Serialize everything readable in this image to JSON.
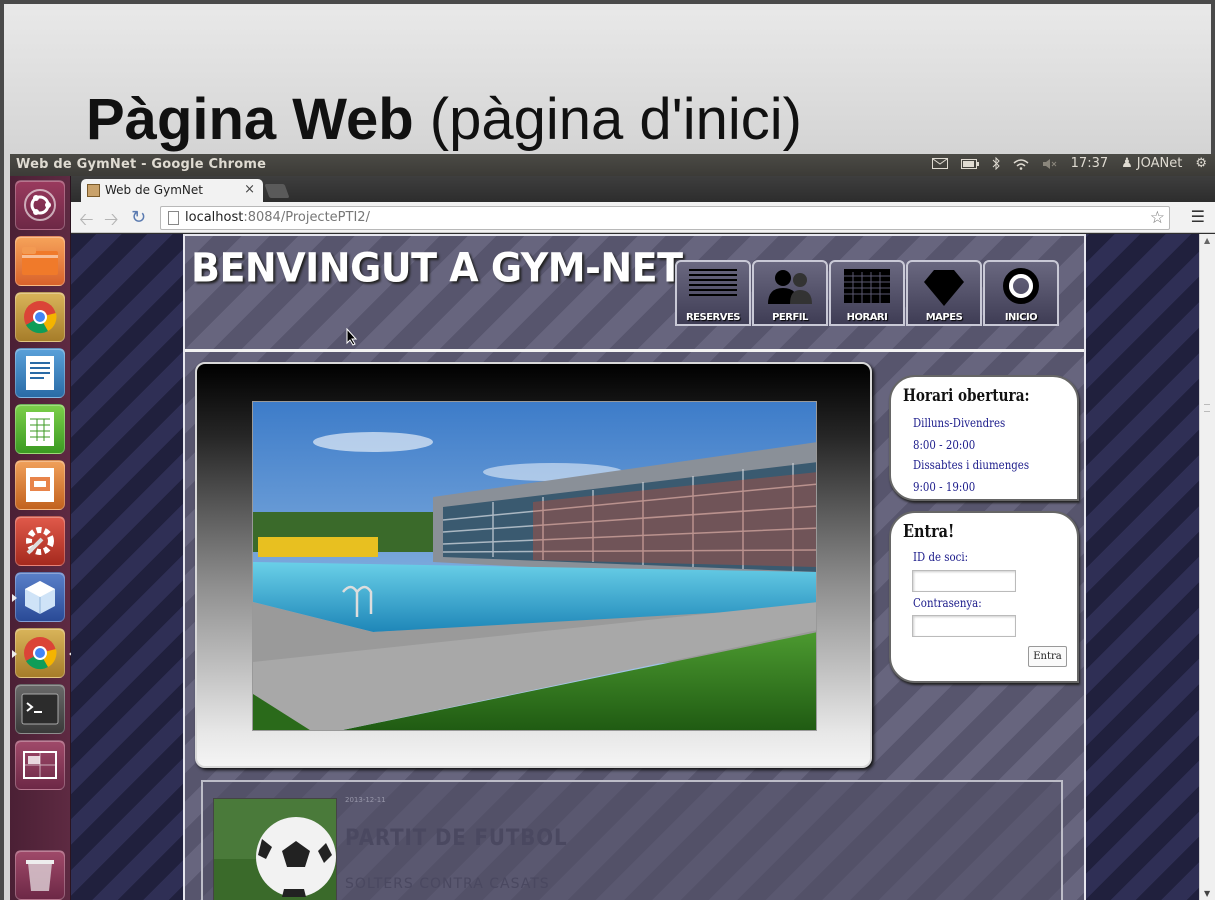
{
  "slide": {
    "title_bold": "Pàgina Web",
    "title_rest": " (pàgina d'inici)"
  },
  "topbar": {
    "window_title": "Web de GymNet - Google Chrome",
    "time": "17:37",
    "user": "JOANet"
  },
  "browser": {
    "tab_title": "Web de GymNet",
    "tab_close": "×",
    "url_host": "localhost",
    "url_path": ":8084/ProjectePTI2/"
  },
  "site": {
    "title": "BENVINGUT A GYM-NET",
    "nav": [
      {
        "label": "RESERVES",
        "icon": "list-icon"
      },
      {
        "label": "PERFIL",
        "icon": "users-icon"
      },
      {
        "label": "HORARI",
        "icon": "calendar-grid-icon"
      },
      {
        "label": "MAPES",
        "icon": "map-pin-icon"
      },
      {
        "label": "INICIO",
        "icon": "ring-icon"
      }
    ],
    "hours": {
      "title": "Horari obertura:",
      "lines": [
        "Dilluns-Divendres",
        "8:00 - 20:00",
        "Dissabtes i diumenges",
        "9:00 - 19:00"
      ]
    },
    "login": {
      "title": "Entra!",
      "id_label": "ID de soci:",
      "password_label": "Contrasenya:",
      "button": "Entra"
    },
    "news": {
      "date": "2013-12-11",
      "title": "PARTIT DE FUTBOL",
      "subtitle": "SOLTERS CONTRA CASATS"
    }
  },
  "colors": {
    "accent_text": "#1a1a8a",
    "site_bg": "#5d5b74",
    "launcher_bg": "#5e2a42"
  }
}
